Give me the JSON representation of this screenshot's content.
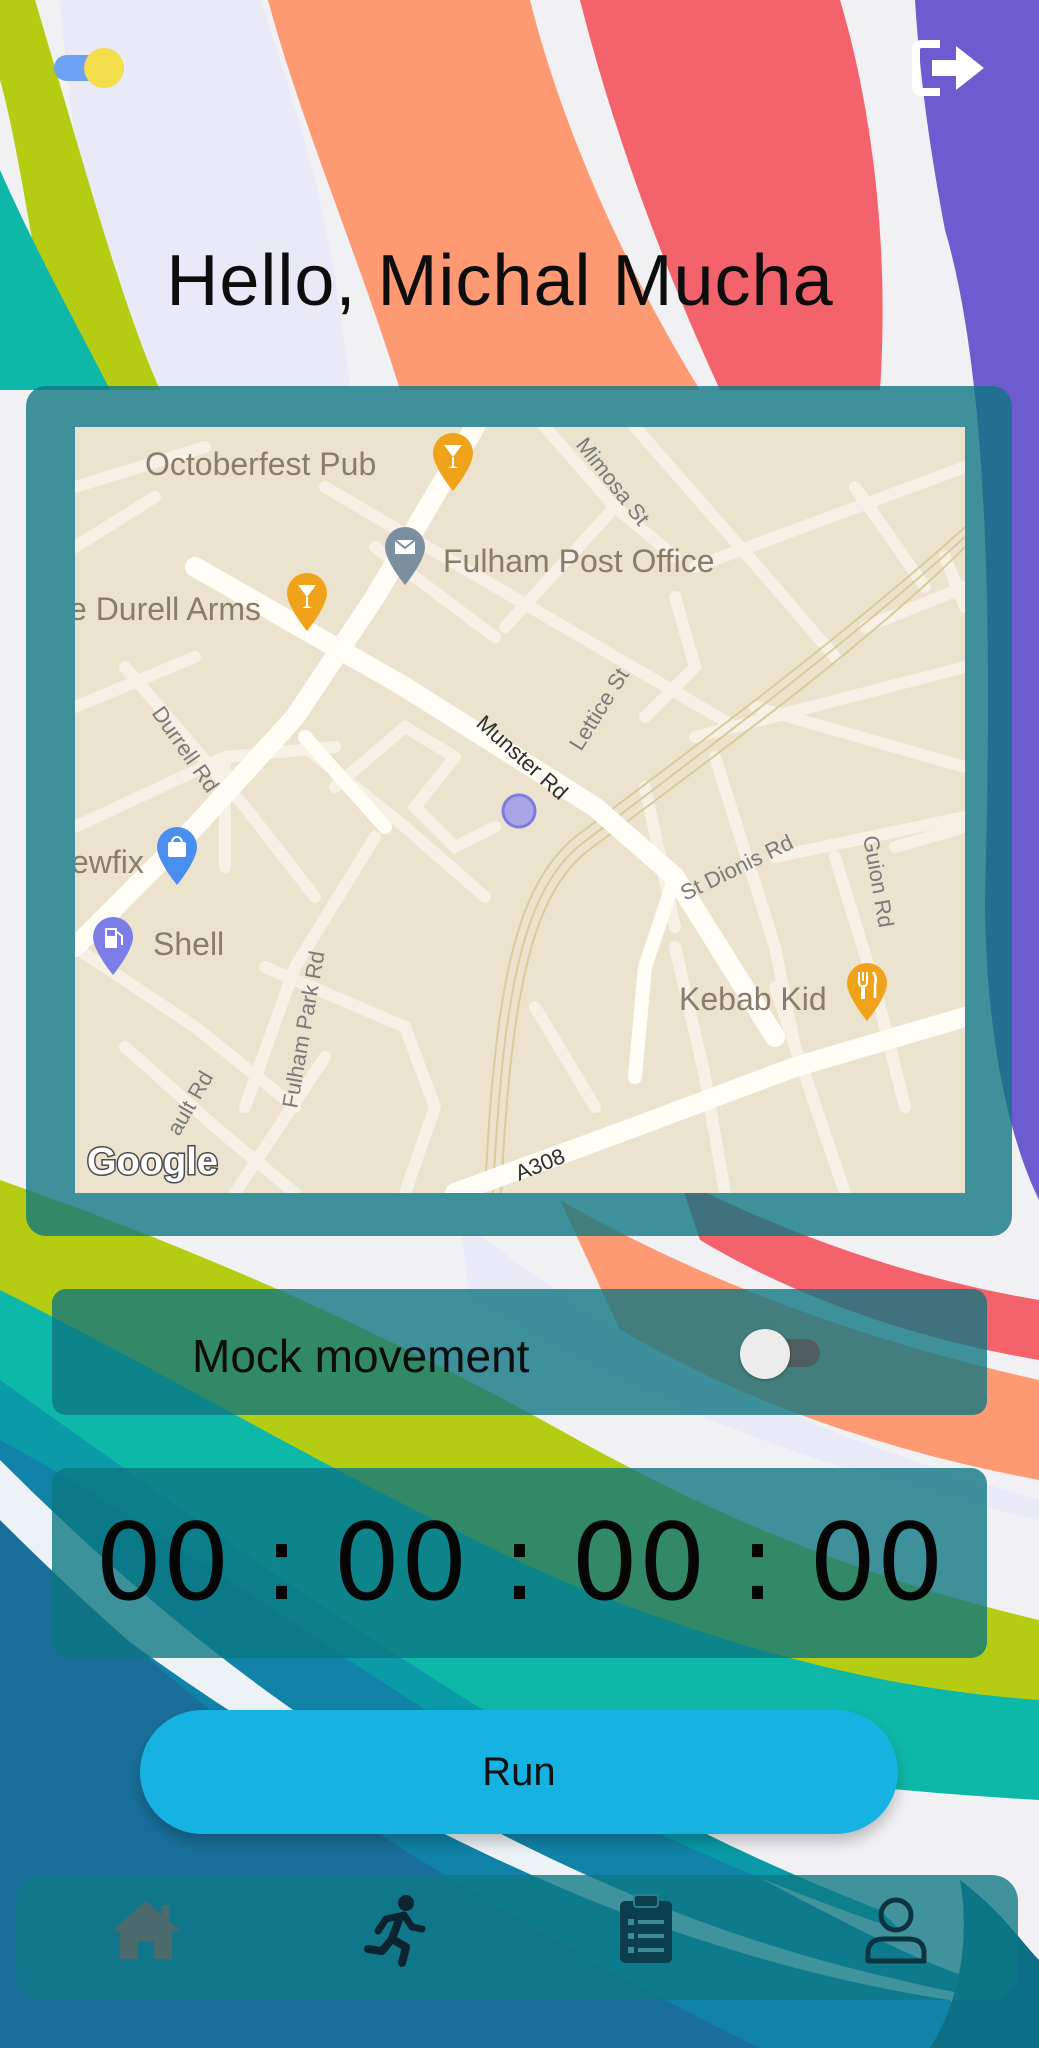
{
  "greeting": "Hello, Michal Mucha",
  "header": {
    "theme_toggle_icon": "theme-toggle-icon",
    "logout_icon": "logout-icon"
  },
  "map": {
    "attribution": "Google",
    "pois": {
      "octoberfest": "Octoberfest Pub",
      "post_office": "Fulham Post Office",
      "durell_arms": "e Durell Arms",
      "newfix": "ewfix",
      "shell": "Shell",
      "kebab": "Kebab Kid"
    },
    "streets": {
      "mimosa": "Mimosa St",
      "lettice": "Lettice St",
      "munster": "Munster Rd",
      "durrell": "Durrell Rd",
      "st_dionis": "St Dionis Rd",
      "guion": "Guion Rd",
      "fulham_park": "Fulham Park Rd",
      "ault": "ault Rd",
      "a308": "A308"
    }
  },
  "mock_movement": {
    "label": "Mock movement",
    "enabled": false
  },
  "timer": {
    "display": "00 : 00 : 00 : 00"
  },
  "run_button": {
    "label": "Run"
  },
  "nav": {
    "items": [
      {
        "icon": "home-icon",
        "active": false
      },
      {
        "icon": "run-icon",
        "active": true
      },
      {
        "icon": "clipboard-icon",
        "active": false
      },
      {
        "icon": "profile-icon",
        "active": false
      }
    ]
  },
  "colors": {
    "accent": "#16b3e2",
    "card": "#0c7680",
    "purple": "#6e5bd0",
    "coral": "#f4636c",
    "salmon": "#fd9a74",
    "lime": "#b4cd12",
    "teal": "#0eb8a8"
  }
}
